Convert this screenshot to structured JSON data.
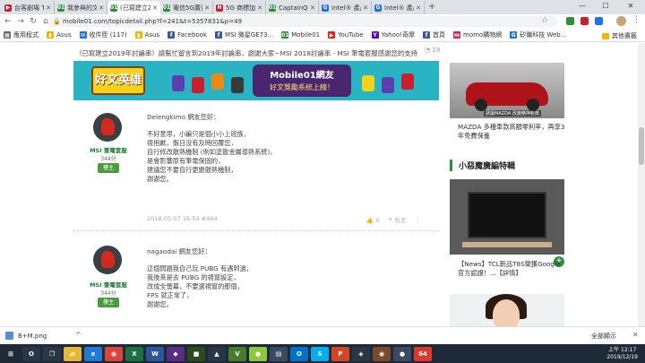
{
  "tabs": [
    {
      "label": "台客劇場 TKstud...",
      "color": "#c8202f",
      "glyph": "▶"
    },
    {
      "label": "我參與的文章",
      "color": "#2d8f3a",
      "glyph": "01"
    },
    {
      "label": "(已寫建立2019...",
      "color": "#2d8f3a",
      "glyph": "01",
      "active": true
    },
    {
      "label": "電信5G廣告 - 小...",
      "color": "#2d8f3a",
      "glyph": "01"
    },
    {
      "label": "5G 商標加速榜...",
      "color": "#c8202f",
      "glyph": "N"
    },
    {
      "label": "CaptainQQ的討論...",
      "color": "#2d8f3a",
      "glyph": "01"
    },
    {
      "label": "Intel® 產品規格...",
      "color": "#1a73e8",
      "glyph": "G"
    },
    {
      "label": "Intel® 產品規格...",
      "color": "#1a73e8",
      "glyph": "G"
    }
  ],
  "window": {
    "minimize": "—",
    "maximize": "☐",
    "close": "✕",
    "newtab": "+"
  },
  "nav": {
    "back": "←",
    "forward": "→",
    "reload": "↻",
    "home": "⌂"
  },
  "address": {
    "url": "mobile01.com/topicdetail.php?f=241&t=5357831&p=49",
    "lock": "🔒",
    "star": "☆"
  },
  "bookmarks": [
    {
      "label": "應用程式",
      "color": "#5f6368",
      "glyph": "▦"
    },
    {
      "label": "Asus",
      "color": "#f4b400",
      "glyph": "▮"
    },
    {
      "label": "收件匣 (117)",
      "color": "#1a73e8",
      "glyph": "✉"
    },
    {
      "label": "Asus",
      "color": "#f4b400",
      "glyph": "▮"
    },
    {
      "label": "Facebook",
      "color": "#3b5998",
      "glyph": "f"
    },
    {
      "label": "MSI 微星GE73...",
      "color": "#3b5998",
      "glyph": "f"
    },
    {
      "label": "Mobile01",
      "color": "#2d8f3a",
      "glyph": "01"
    },
    {
      "label": "YouTube",
      "color": "#e62117",
      "glyph": "▶"
    },
    {
      "label": "Yahoo!奇摩",
      "color": "#6001d2",
      "glyph": "Y"
    },
    {
      "label": "首頁",
      "color": "#3b5998",
      "glyph": "f"
    },
    {
      "label": "momo購物網",
      "color": "#d81b60",
      "glyph": "m"
    },
    {
      "label": "矽職科技 Web...",
      "color": "#1a73e8",
      "glyph": "G"
    }
  ],
  "bookmarks_more": "其他書籤",
  "headline": "（已寫建立2019年討論串）請幫忙留言到2019年討論串，謝謝大家~MSI 2018討論串 - MSI 筆電套服感謝您的支持",
  "headline_counts": {
    "views": "19",
    "replies": "19"
  },
  "banner": {
    "left": "好文英雄",
    "title": "Mobile01網友",
    "subtitle": "好文獎勵系統上線！"
  },
  "posts": [
    {
      "user": "MSI 筆電套服",
      "score": "344分",
      "badge": "樓主",
      "greeting": "Delengkimo 網友您好：",
      "lines": [
        "不好意思，小編只是個小小上班族，",
        "很抱歉，假日沒有及時回覆您，",
        "自行修改散熱機制 (例如塗散金屬導熱系統)，",
        "是會影響原有筆電保固的，",
        "建議您不要自行更變散熱機制，",
        "謝謝您。"
      ],
      "meta": "2018-05-07 16:54 #464",
      "likes": "0",
      "reply": "引言",
      "share": "⋮"
    },
    {
      "user": "MSI 筆電套服",
      "score": "344分",
      "badge": "樓主",
      "greeting": "nagaodai 網友您好：",
      "lines": [
        "這個問題我自己玩 PUBG 有遇到過，",
        "我後來是去 PUBG 的視窗設定，",
        "改成全螢幕，不要選視窗的那個，",
        "FPS 就正常了，",
        "謝謝您。"
      ]
    }
  ],
  "sidebar": {
    "ad_caption": "請讓MAZDA 改變精神新典",
    "ad_text": "MAZDA 多種車款高額零利率，再享3年免費保養",
    "section_title": "小惡魔廣編特輯",
    "tv_text": "【News】TCL新品T8S榮獲Google官方認證！...【詳情】",
    "plus": "+"
  },
  "download": {
    "file": "B+M.png",
    "chevron": "^",
    "show_all": "全部顯示",
    "close": "✕"
  },
  "taskbar": {
    "icons": [
      {
        "glyph": "⊞",
        "color": "#1f2a38"
      },
      {
        "glyph": "O",
        "color": "#2a3646"
      },
      {
        "glyph": "❐",
        "color": "#2a3646"
      },
      {
        "glyph": "📁",
        "color": "#e8b43a"
      },
      {
        "glyph": "e",
        "color": "#1e7bd6"
      },
      {
        "glyph": "◉",
        "color": "#db4437"
      },
      {
        "glyph": "X",
        "color": "#1d7044"
      },
      {
        "glyph": "W",
        "color": "#2b579a"
      },
      {
        "glyph": "◆",
        "color": "#5a2c86"
      },
      {
        "glyph": "■",
        "color": "#2d4a1e"
      },
      {
        "glyph": "▲",
        "color": "#2a3646"
      },
      {
        "glyph": "V",
        "color": "#4a7a2a"
      },
      {
        "glyph": "●",
        "color": "#8fc63f"
      },
      {
        "glyph": "▤",
        "color": "#3a4b61"
      },
      {
        "glyph": "O",
        "color": "#0072c6"
      },
      {
        "glyph": "S",
        "color": "#00aff0"
      },
      {
        "glyph": "P",
        "color": "#d24726"
      },
      {
        "glyph": "◈",
        "color": "#2a3646"
      },
      {
        "glyph": "◉",
        "color": "#7a4a2a"
      },
      {
        "glyph": "●",
        "color": "#3a4b61"
      },
      {
        "glyph": "64",
        "color": "#d83b2a"
      }
    ],
    "time": "上午 12:17",
    "date": "2019/12/19"
  }
}
